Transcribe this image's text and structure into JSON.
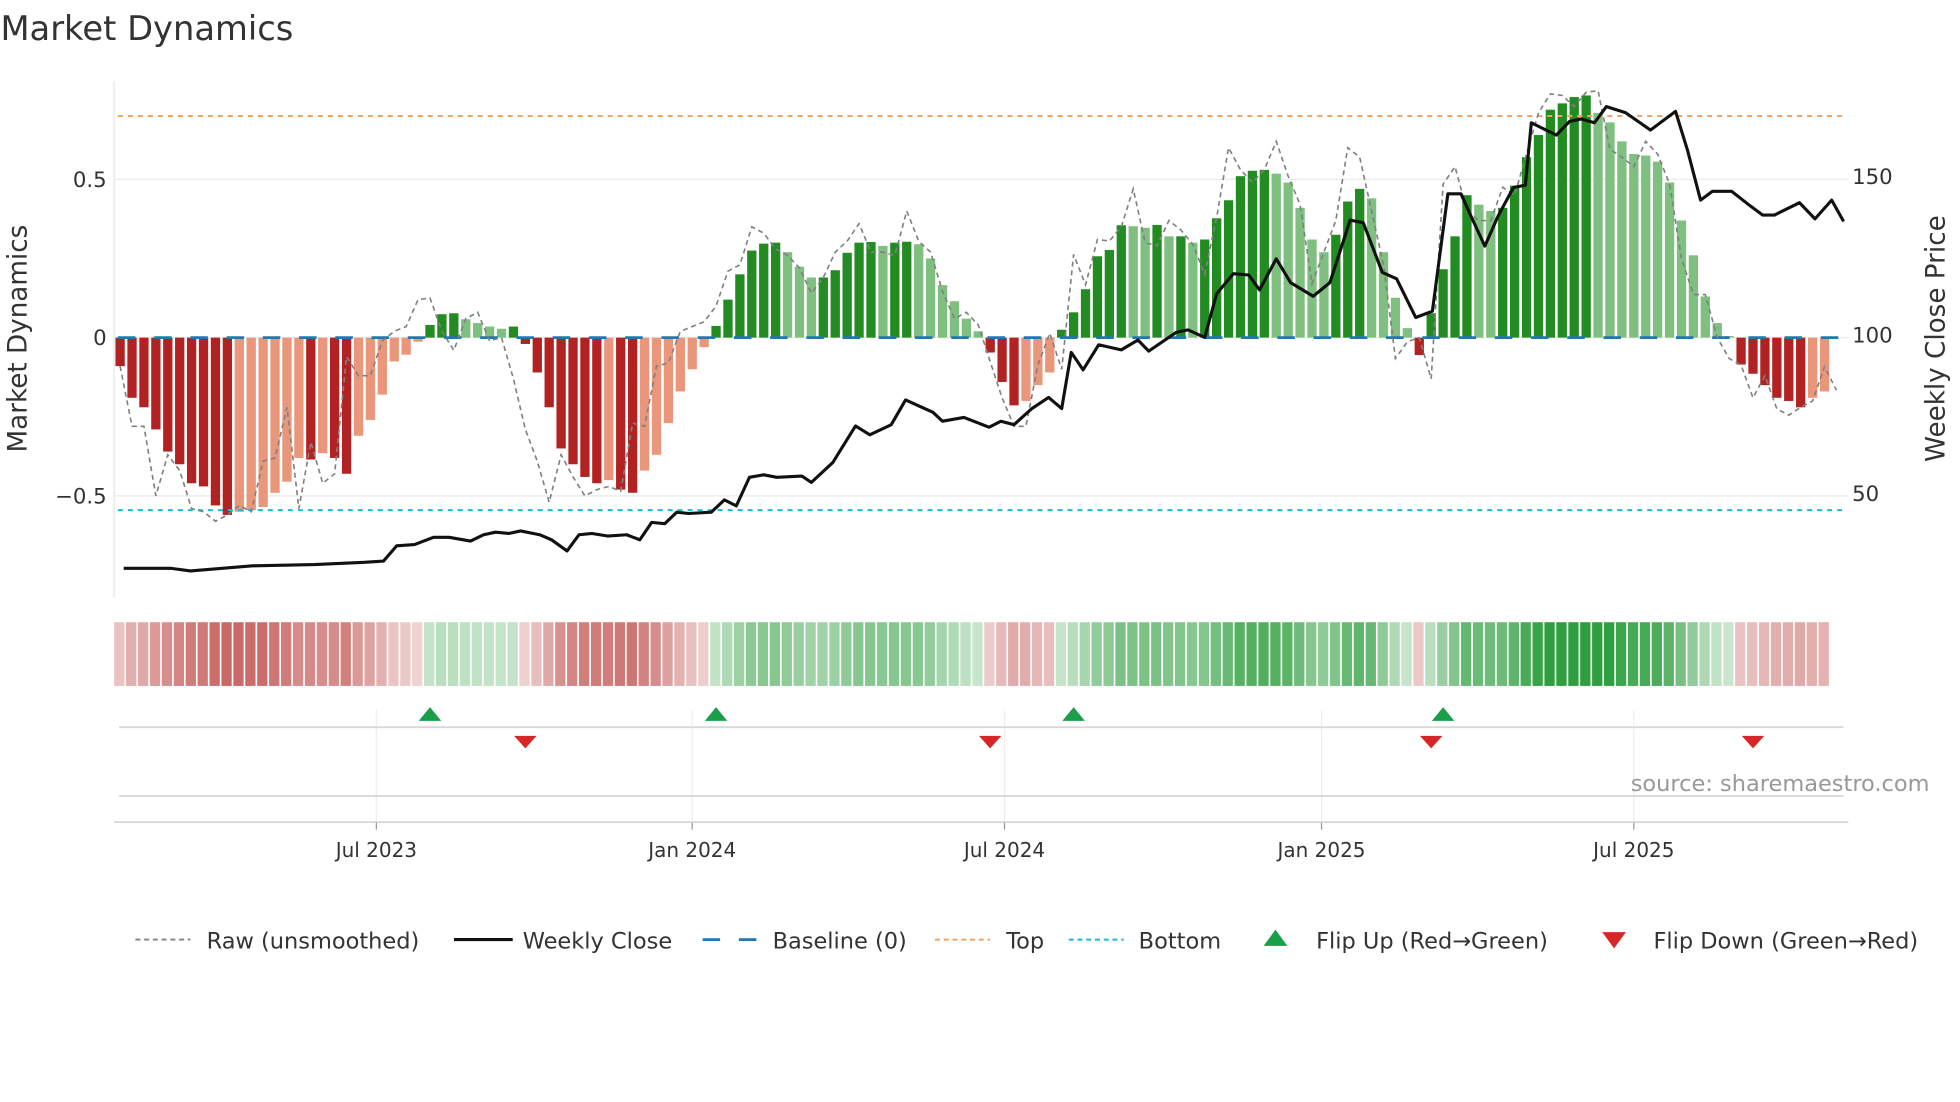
{
  "title": "Market Dynamics",
  "source": "source: sharemaestro.com",
  "colors": {
    "red_strong": "#b22222",
    "red_weak": "#e9967a",
    "green_strong": "#228b22",
    "green_weak": "#7fbf7f",
    "baseline": "#1f77b4",
    "top": "#f4a460",
    "bottom": "#17becf",
    "raw": "#808080",
    "close": "#111111",
    "flip_up": "#1a9e4a",
    "flip_down": "#d62728"
  },
  "chart_data": {
    "type": "bar",
    "title": "Market Dynamics",
    "ylabel": "Market Dynamics",
    "ylabel_right": "Weekly Close Price",
    "ylim": [
      -0.82,
      0.81
    ],
    "ylim_right": [
      17.3,
      180
    ],
    "yticks": [
      {
        "value": 0.5,
        "label": "0.5"
      },
      {
        "value": 0,
        "label": "0"
      },
      {
        "value": -0.5,
        "label": "−0.5"
      }
    ],
    "yticks_right": [
      {
        "value": 150,
        "label": "150"
      },
      {
        "value": 100,
        "label": "100"
      },
      {
        "value": 50,
        "label": "50"
      }
    ],
    "x_unit": "week index",
    "xlim": [
      -0.5,
      145
    ],
    "xticks": [
      {
        "week": 21.5,
        "label": "Jul 2023"
      },
      {
        "week": 48.0,
        "label": "Jan 2024"
      },
      {
        "week": 74.2,
        "label": "Jul 2024"
      },
      {
        "week": 100.8,
        "label": "Jan 2025"
      },
      {
        "week": 127.0,
        "label": "Jul 2025"
      }
    ],
    "top_level": 0.7,
    "bottom_level": -0.545,
    "baseline": 0,
    "values": [
      -0.09,
      -0.19,
      -0.22,
      -0.29,
      -0.36,
      -0.4,
      -0.46,
      -0.47,
      -0.53,
      -0.56,
      -0.55,
      -0.545,
      -0.535,
      -0.49,
      -0.455,
      -0.38,
      -0.385,
      -0.365,
      -0.38,
      -0.43,
      -0.31,
      -0.26,
      -0.18,
      -0.075,
      -0.054,
      -0.013,
      0.04,
      0.074,
      0.077,
      0.058,
      0.046,
      0.035,
      0.028,
      0.035,
      -0.02,
      -0.11,
      -0.22,
      -0.35,
      -0.4,
      -0.44,
      -0.46,
      -0.45,
      -0.48,
      -0.49,
      -0.42,
      -0.37,
      -0.27,
      -0.17,
      -0.1,
      -0.03,
      0.037,
      0.12,
      0.2,
      0.275,
      0.297,
      0.3,
      0.27,
      0.224,
      0.19,
      0.19,
      0.213,
      0.268,
      0.3,
      0.302,
      0.29,
      0.3,
      0.303,
      0.295,
      0.25,
      0.166,
      0.115,
      0.06,
      0.02,
      -0.047,
      -0.14,
      -0.214,
      -0.2,
      -0.15,
      -0.11,
      0.025,
      0.08,
      0.153,
      0.257,
      0.277,
      0.355,
      0.352,
      0.347,
      0.356,
      0.32,
      0.32,
      0.3,
      0.31,
      0.377,
      0.434,
      0.51,
      0.527,
      0.53,
      0.518,
      0.49,
      0.41,
      0.31,
      0.27,
      0.325,
      0.43,
      0.47,
      0.44,
      0.27,
      0.126,
      0.03,
      -0.055,
      0.077,
      0.216,
      0.32,
      0.45,
      0.42,
      0.4,
      0.41,
      0.48,
      0.57,
      0.64,
      0.72,
      0.74,
      0.76,
      0.765,
      0.71,
      0.68,
      0.62,
      0.58,
      0.575,
      0.556,
      0.49,
      0.37,
      0.26,
      0.13,
      0.046,
      0.005,
      -0.085,
      -0.114,
      -0.15,
      -0.19,
      -0.2,
      -0.22,
      -0.19,
      -0.17
    ],
    "raw": [
      -0.09,
      -0.28,
      -0.28,
      -0.5,
      -0.37,
      -0.42,
      -0.54,
      -0.55,
      -0.58,
      -0.56,
      -0.53,
      -0.55,
      -0.39,
      -0.38,
      -0.22,
      -0.54,
      -0.33,
      -0.46,
      -0.43,
      -0.06,
      -0.12,
      -0.12,
      -0.01,
      0.02,
      0.035,
      0.12,
      0.125,
      0.02,
      -0.04,
      0.06,
      0.08,
      -0.01,
      0.0,
      -0.13,
      -0.29,
      -0.39,
      -0.52,
      -0.37,
      -0.44,
      -0.5,
      -0.48,
      -0.47,
      -0.485,
      -0.27,
      -0.28,
      -0.09,
      -0.08,
      0.02,
      0.035,
      0.05,
      0.1,
      0.21,
      0.23,
      0.35,
      0.33,
      0.28,
      0.26,
      0.22,
      0.14,
      0.19,
      0.27,
      0.305,
      0.36,
      0.27,
      0.27,
      0.26,
      0.4,
      0.305,
      0.27,
      0.146,
      0.06,
      0.08,
      0.04,
      -0.076,
      -0.19,
      -0.28,
      -0.28,
      -0.087,
      0.014,
      -0.1,
      0.263,
      0.167,
      0.31,
      0.305,
      0.35,
      0.47,
      0.3,
      0.29,
      0.37,
      0.34,
      0.295,
      0.2,
      0.38,
      0.6,
      0.53,
      0.49,
      0.53,
      0.62,
      0.51,
      0.42,
      0.17,
      0.27,
      0.37,
      0.6,
      0.57,
      0.4,
      0.23,
      -0.066,
      -0.013,
      0.0,
      -0.13,
      0.485,
      0.54,
      0.4,
      0.37,
      0.37,
      0.475,
      0.45,
      0.58,
      0.71,
      0.77,
      0.765,
      0.73,
      0.775,
      0.78,
      0.595,
      0.57,
      0.54,
      0.62,
      0.58,
      0.485,
      0.25,
      0.136,
      0.136,
      0.0,
      -0.066,
      -0.087,
      -0.19,
      -0.12,
      -0.225,
      -0.245,
      -0.22,
      -0.2,
      -0.092,
      -0.166
    ],
    "weekly_close": [
      [
        0.3,
        26.4
      ],
      [
        4.3,
        26.4
      ],
      [
        5.9,
        25.6
      ],
      [
        11.1,
        27.2
      ],
      [
        16.3,
        27.6
      ],
      [
        20.5,
        28.3
      ],
      [
        22.1,
        28.7
      ],
      [
        23.2,
        33.5
      ],
      [
        24.7,
        33.9
      ],
      [
        26.3,
        36.2
      ],
      [
        27.6,
        36.2
      ],
      [
        29.4,
        35.0
      ],
      [
        30.5,
        37.0
      ],
      [
        31.5,
        37.8
      ],
      [
        32.6,
        37.4
      ],
      [
        33.6,
        38.2
      ],
      [
        35.2,
        37.0
      ],
      [
        36.2,
        35.4
      ],
      [
        37.5,
        31.9
      ],
      [
        38.5,
        37.0
      ],
      [
        39.6,
        37.4
      ],
      [
        40.9,
        36.6
      ],
      [
        42.5,
        37.0
      ],
      [
        43.6,
        35.4
      ],
      [
        44.6,
        40.9
      ],
      [
        45.7,
        40.5
      ],
      [
        46.7,
        44.1
      ],
      [
        47.7,
        43.7
      ],
      [
        49.6,
        44.1
      ],
      [
        50.7,
        48.0
      ],
      [
        51.7,
        46.1
      ],
      [
        52.8,
        55.1
      ],
      [
        54.0,
        55.9
      ],
      [
        55.1,
        55.1
      ],
      [
        57.2,
        55.5
      ],
      [
        58.0,
        53.5
      ],
      [
        59.8,
        59.8
      ],
      [
        61.7,
        71.3
      ],
      [
        62.9,
        68.5
      ],
      [
        64.7,
        71.7
      ],
      [
        65.9,
        79.5
      ],
      [
        68.2,
        75.6
      ],
      [
        69.0,
        72.8
      ],
      [
        70.8,
        74.0
      ],
      [
        72.9,
        70.9
      ],
      [
        73.9,
        72.8
      ],
      [
        75.0,
        71.7
      ],
      [
        76.5,
        76.8
      ],
      [
        77.9,
        80.3
      ],
      [
        79.0,
        76.8
      ],
      [
        79.8,
        94.5
      ],
      [
        80.8,
        89.0
      ],
      [
        82.1,
        96.9
      ],
      [
        84.0,
        95.3
      ],
      [
        85.4,
        98.4
      ],
      [
        86.3,
        94.9
      ],
      [
        88.6,
        100.8
      ],
      [
        89.6,
        101.6
      ],
      [
        91.0,
        99.2
      ],
      [
        92.0,
        113.0
      ],
      [
        93.4,
        119.3
      ],
      [
        94.7,
        118.9
      ],
      [
        95.6,
        114.2
      ],
      [
        97.0,
        124.0
      ],
      [
        98.2,
        116.5
      ],
      [
        100.1,
        112.2
      ],
      [
        101.5,
        116.5
      ],
      [
        103.2,
        136.2
      ],
      [
        104.3,
        135.4
      ],
      [
        105.9,
        119.7
      ],
      [
        107.1,
        117.7
      ],
      [
        108.7,
        105.5
      ],
      [
        110.1,
        107.5
      ],
      [
        111.4,
        144.5
      ],
      [
        112.5,
        144.5
      ],
      [
        113.2,
        138.6
      ],
      [
        114.5,
        128.0
      ],
      [
        115.6,
        137.4
      ],
      [
        116.9,
        146.5
      ],
      [
        117.9,
        147.2
      ],
      [
        118.4,
        166.9
      ],
      [
        120.5,
        163.0
      ],
      [
        121.6,
        167.3
      ],
      [
        122.6,
        168.1
      ],
      [
        123.7,
        166.9
      ],
      [
        124.7,
        172.0
      ],
      [
        126.3,
        170.1
      ],
      [
        128.4,
        164.6
      ],
      [
        130.5,
        170.5
      ],
      [
        131.5,
        158.3
      ],
      [
        132.6,
        142.5
      ],
      [
        133.6,
        145.3
      ],
      [
        135.2,
        145.3
      ],
      [
        136.8,
        140.6
      ],
      [
        137.8,
        137.8
      ],
      [
        138.8,
        137.8
      ],
      [
        140.9,
        141.7
      ],
      [
        142.2,
        136.6
      ],
      [
        143.6,
        142.5
      ],
      [
        144.6,
        135.8
      ]
    ],
    "flips_up": [
      26,
      50,
      80,
      111
    ],
    "flips_down": [
      34,
      73,
      110,
      137
    ],
    "legend": [
      {
        "key": "raw",
        "label": "Raw (unsmoothed)"
      },
      {
        "key": "close",
        "label": "Weekly Close"
      },
      {
        "key": "baseline",
        "label": "Baseline (0)"
      },
      {
        "key": "top",
        "label": "Top"
      },
      {
        "key": "bottom",
        "label": "Bottom"
      },
      {
        "key": "flip_up",
        "label": "Flip Up (Red→Green)"
      },
      {
        "key": "flip_down",
        "label": "Flip Down (Green→Red)"
      }
    ],
    "legend_position": "bottom"
  }
}
